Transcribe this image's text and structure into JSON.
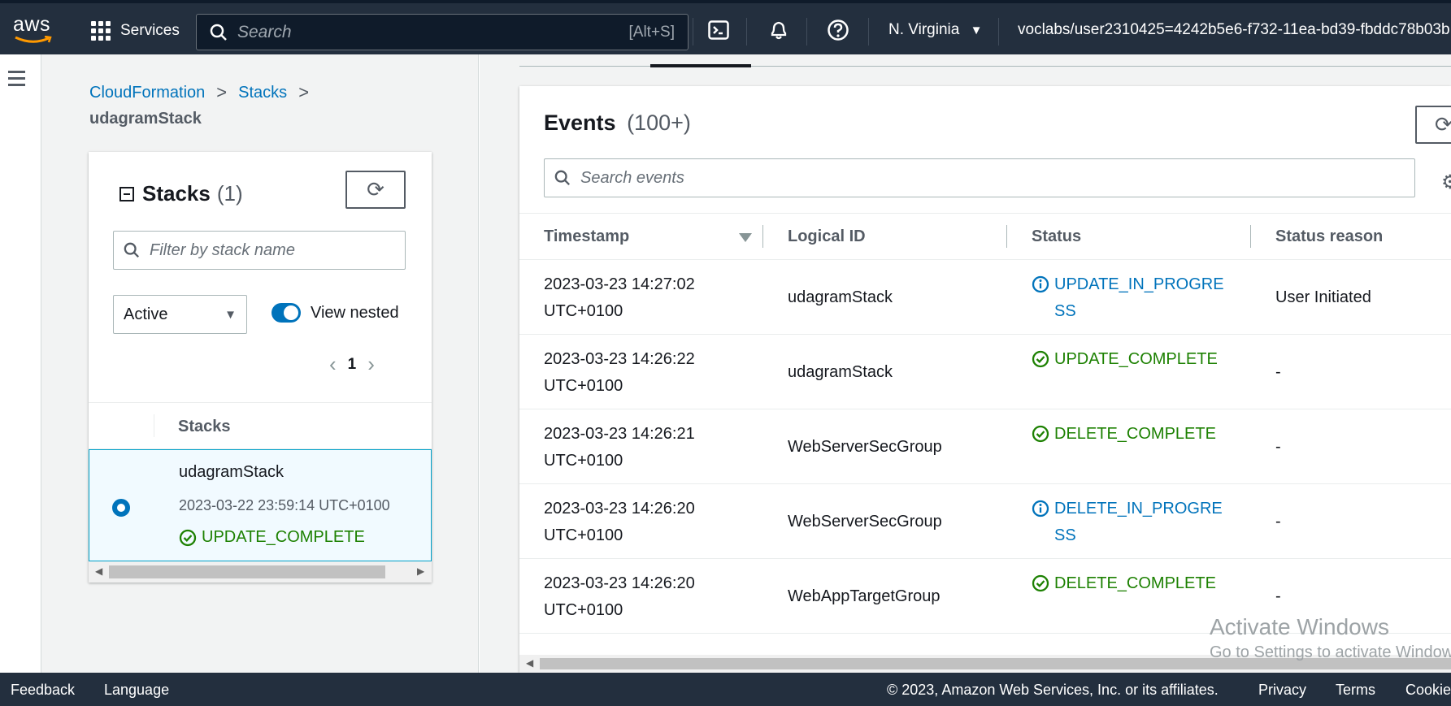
{
  "nav": {
    "logo_text": "aws",
    "services_label": "Services",
    "search_placeholder": "Search",
    "search_shortcut": "[Alt+S]",
    "region": "N. Virginia",
    "account": "voclabs/user2310425=4242b5e6-f732-11ea-bd39-fbddc78b03b"
  },
  "breadcrumb": {
    "items": [
      "CloudFormation",
      "Stacks"
    ],
    "current": "udagramStack"
  },
  "stacks_panel": {
    "title": "Stacks",
    "count": "(1)",
    "filter_placeholder": "Filter by stack name",
    "filter_select": "Active",
    "view_nested_label": "View nested",
    "view_nested_on": true,
    "page": "1",
    "column_header": "Stacks",
    "rows": [
      {
        "name": "udagramStack",
        "created": "2023-03-22 23:59:14 UTC+0100",
        "status": "UPDATE_COMPLETE",
        "selected": true
      }
    ]
  },
  "events": {
    "title": "Events",
    "count": "(100+)",
    "search_placeholder": "Search events",
    "columns": [
      "Timestamp",
      "Logical ID",
      "Status",
      "Status reason"
    ],
    "rows": [
      {
        "timestamp": "2023-03-23 14:27:02 UTC+0100",
        "logical_id": "udagramStack",
        "status": "UPDATE_IN_PROGRESS",
        "status_kind": "info",
        "reason": "User Initiated"
      },
      {
        "timestamp": "2023-03-23 14:26:22 UTC+0100",
        "logical_id": "udagramStack",
        "status": "UPDATE_COMPLETE",
        "status_kind": "success",
        "reason": "-"
      },
      {
        "timestamp": "2023-03-23 14:26:21 UTC+0100",
        "logical_id": "WebServerSecGroup",
        "status": "DELETE_COMPLETE",
        "status_kind": "success",
        "reason": "-"
      },
      {
        "timestamp": "2023-03-23 14:26:20 UTC+0100",
        "logical_id": "WebServerSecGroup",
        "status": "DELETE_IN_PROGRESS",
        "status_kind": "info",
        "reason": "-"
      },
      {
        "timestamp": "2023-03-23 14:26:20 UTC+0100",
        "logical_id": "WebAppTargetGroup",
        "status": "DELETE_COMPLETE",
        "status_kind": "success",
        "reason": "-"
      }
    ]
  },
  "watermark": {
    "line1": "Activate Windows",
    "line2": "Go to Settings to activate Windows."
  },
  "footer": {
    "feedback": "Feedback",
    "language": "Language",
    "copyright": "© 2023, Amazon Web Services, Inc. or its affiliates.",
    "privacy": "Privacy",
    "terms": "Terms",
    "cookie": "Cookie preferences"
  },
  "colors": {
    "nav_bg": "#232f3e",
    "link": "#0073bb",
    "success": "#1d8102",
    "selected_row_bg": "#f1faff"
  }
}
